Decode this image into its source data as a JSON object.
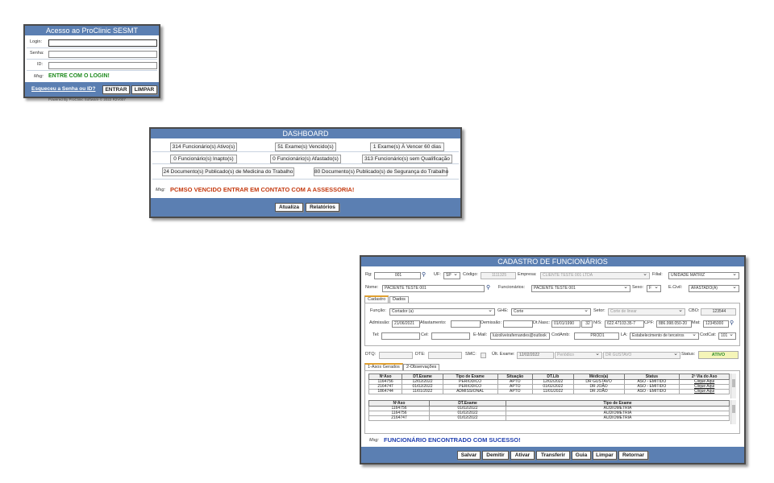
{
  "login": {
    "title": "Acesso ao ProClinic SESMT",
    "login_label": "Login:",
    "senha_label": "Senha:",
    "id_label": "ID:",
    "msg_label": "Msg:",
    "msg": "ENTRE COM O LOGIN!",
    "forgot_link": "Esqueceu a Senha ou ID?",
    "enter_button": "ENTRAR",
    "clear_button": "LIMPAR",
    "footer": "Powered By ProClinic Software © 2022 R2V007"
  },
  "dashboard": {
    "title": "DASHBOARD",
    "row1": [
      "314 Funcionário(s) Ativo(s)",
      "51 Exame(s) Vencido(s)",
      "1 Exame(s) À Vencer 60 dias"
    ],
    "row2": [
      "0 Funcionário(s) Inapto(s)",
      "0 Funcionário(s) Afastado(s)",
      "313 Funcionário(s) sem Qualificação"
    ],
    "row3": [
      "24 Documento(s) Publicado(s) de Medicina do Trabalho",
      "80 Documento(s) Publicado(s) de Segurança do Trabalho"
    ],
    "msg_label": "Msg:",
    "msg": "PCMSO VENCIDO ENTRAR EM CONTATO COM A ASSESSORIA!",
    "update_button": "Atualiza",
    "reports_button": "Relatórios"
  },
  "cadastro": {
    "title": "CADASTRO DE FUNCIONÁRIOS",
    "labels": {
      "rg": "Rg:",
      "uf": "UF:",
      "codigo": "Código:",
      "empresa": "Empresa:",
      "filial": "Filial:",
      "nome": "Nome:",
      "funcionarios": "Funcionários:",
      "sexo": "Sexo:",
      "ecivil": "E.Civil:",
      "funcao": "Função:",
      "ghe": "GHE:",
      "setor": "Setor:",
      "cbo": "CBO:",
      "admissao": "Admissão:",
      "afastamento": "Afastamento:",
      "demissao": "Demissão:",
      "dtnasc": "Dt.Nasc:",
      "nis": "NIS:",
      "cpf": "CPF:",
      "mat": "Mat:",
      "tel": "Tel:",
      "cel": "Cel:",
      "email": "E-Mail:",
      "codamb": "CodAmb:",
      "la": "LA:",
      "codcat": "CodCat:",
      "dtq": "DTQ:",
      "dte": "DTE:",
      "smc": "SMC:",
      "ult_exame": "Últ. Exame:",
      "status": "Status:",
      "msg": "Msg:"
    },
    "values": {
      "rg": "001",
      "uf": "SP",
      "codigo": "1111325",
      "empresa": "CLIENTE TESTE 001 LTDA",
      "filial": "UNIDADE MATRIZ",
      "nome": "PACIENTE TESTE 001",
      "funcionarios": "PACIENTE TESTE 001",
      "sexo": "F",
      "ecivil": "AFASTADO(A)",
      "funcao": "Cortador (a)",
      "ghe": "Corte",
      "setor": "Corte de linear",
      "cbo": "123544",
      "admissao": "21/06/2021",
      "afastamento": "",
      "demissao": "",
      "dtnasc": "01/01/1990",
      "idade": "32",
      "nis": "622.47103.35-7",
      "cpf": "886.998.050-20",
      "mat": "12345000",
      "tel": "",
      "cel": "",
      "email": "luizoliveirafernandes@outlook",
      "codamb": "PROD1",
      "la": "Estabelecimento de terceiros",
      "codcat": "101",
      "dtq": "",
      "dte": "",
      "ult_exame": "12/02/2022",
      "ult_tipo": "Periódico",
      "ult_medico": "DR GUSTAVO",
      "status": "ATIVO"
    },
    "tabs": [
      "Cadastro",
      "Dados"
    ],
    "sub_tabs": [
      "1-Asos Gerados",
      "2-Observações"
    ],
    "aso_headers": [
      "NºAso",
      "DT.Exame",
      "Tipo de Exame",
      "Situação",
      "DT.Lib",
      "Médico(a)",
      "Status",
      "2ª Via do Aso"
    ],
    "aso_rows": [
      [
        "1164756",
        "12/02/2022",
        "PERIODICO",
        "APTO",
        "12/02/2022",
        "DR GUSTAVO",
        "ASO - EMITIDO",
        "Clique Aqui"
      ],
      [
        "2164747",
        "01/02/2022",
        "PERIODICO",
        "APTO",
        "01/02/2022",
        "DR JOÃO",
        "ASO - EMITIDO",
        "Clique Aqui"
      ],
      [
        "1864744",
        "11/01/2022",
        "ADMISSIONAL",
        "APTO",
        "11/01/2022",
        "DR JOÃO",
        "ASO - EMITIDO",
        "Clique Aqui"
      ]
    ],
    "exam_headers": [
      "NºAso",
      "DT.Exame",
      "Tipo de Exame"
    ],
    "exam_rows": [
      [
        "1164756",
        "01/02/2022",
        "AUDIOMETRIA"
      ],
      [
        "1164756",
        "01/02/2022",
        "AUDIOMETRIA"
      ],
      [
        "2164747",
        "01/02/2022",
        "AUDIOMETRIA"
      ]
    ],
    "msg": "FUNCIONÁRIO ENCONTRADO COM SUCESSO!",
    "buttons": [
      "Salvar",
      "Demitir",
      "Ativar",
      "Transferir",
      "Guia",
      "Limpar",
      "Retornar"
    ],
    "icons": {
      "search": "binoculars-icon"
    }
  }
}
